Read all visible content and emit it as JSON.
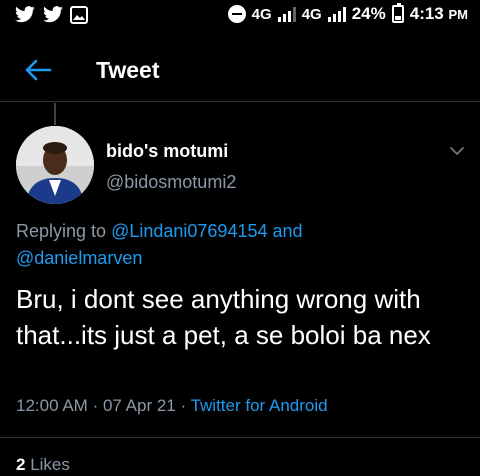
{
  "status_bar": {
    "icons": [
      "twitter-icon",
      "twitter-icon",
      "image-icon"
    ],
    "network_1": "4G",
    "network_2": "4G",
    "battery_percent": "24%",
    "time": "4:13",
    "time_suffix": "PM",
    "battery_level": 0.24
  },
  "header": {
    "back_icon": "back-arrow-icon",
    "title": "Tweet"
  },
  "tweet": {
    "author": {
      "display_name": "bido's motumi",
      "handle": "@bidosmotumi2"
    },
    "replying_prefix": "Replying to",
    "replying_user_1": "@Lindani07694154",
    "replying_and": "and",
    "replying_user_2": "@danielmarven",
    "text": "Bru, i dont see anything wrong with that...its just a pet, a se boloi ba nex",
    "time": "12:00 AM",
    "sep_1": "·",
    "date": "07 Apr 21",
    "sep_2": "·",
    "source": "Twitter for Android",
    "likes_count": "2",
    "likes_label": "Likes"
  },
  "colors": {
    "background": "#000000",
    "accent": "#1d9bf0",
    "secondary_text": "#8b98a5"
  }
}
